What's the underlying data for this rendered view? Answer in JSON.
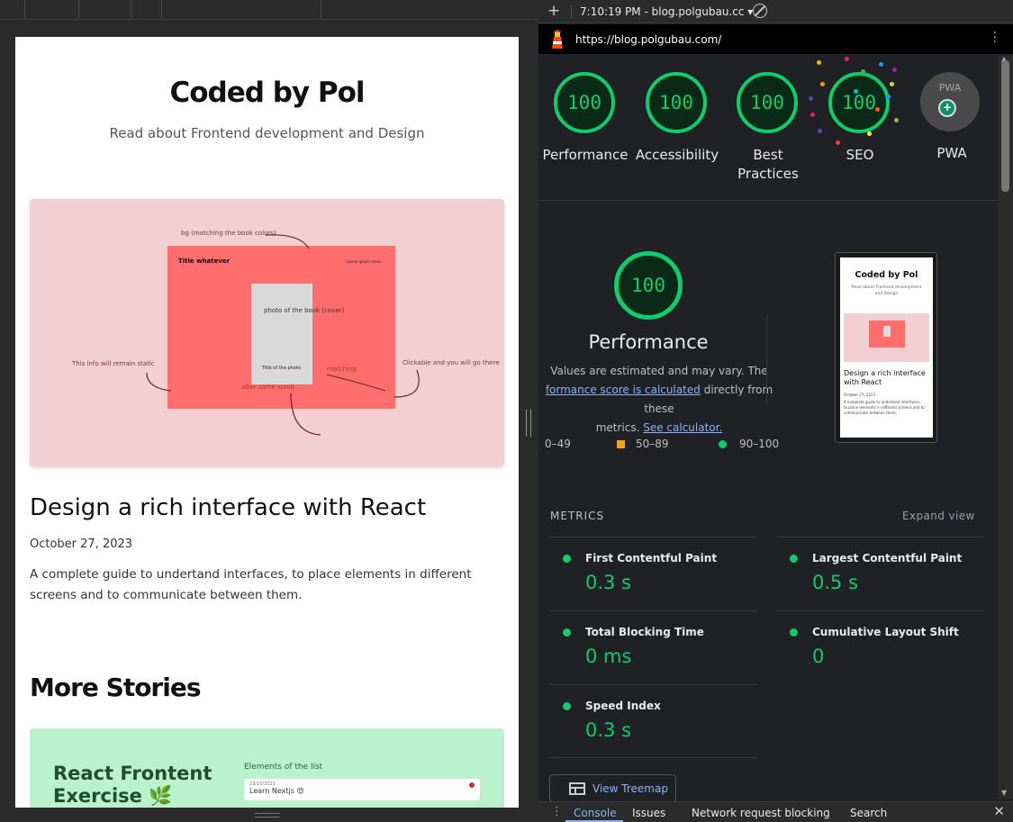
{
  "device": {
    "site_title": "Coded by Pol",
    "site_subtitle": "Read about Frontend development and Design",
    "hero_annotations": {
      "bg_note": "bg (matching the book colors)",
      "title_whatever": "Title whatever",
      "small_corner": "Lorem ipsum  more...",
      "photo_label": "photo of the book (cover)",
      "title_of_photo": "Title of the photo",
      "static_note": "This info will remain static",
      "matching": "matching",
      "after_scroll": "after some scroll",
      "clickable_note": "Clickable and you will go there"
    },
    "post": {
      "title": "Design a rich interface with React",
      "date": "October 27, 2023",
      "excerpt": "A complete guide to undertand interfaces, to place elements in different screens and to communicate between them."
    },
    "more_stories": "More Stories",
    "story_card": {
      "title": "React Frontent Exercise 🌿",
      "elements_label": "Elements of the list",
      "item_date": "23/10/2023",
      "item_text": "Learn Nextjs 😍"
    }
  },
  "devtools": {
    "toolbar": {
      "plus": "+",
      "report_label": "7:10:19 PM - blog.polgubau.cc ▾"
    },
    "url": "https://blog.polgubau.com/",
    "scores": [
      {
        "label": "Performance",
        "value": "100"
      },
      {
        "label": "Accessibility",
        "value": "100"
      },
      {
        "label": "Best Practices",
        "value": "100"
      },
      {
        "label": "SEO",
        "value": "100"
      }
    ],
    "pwa": {
      "label": "PWA",
      "badge_text": "PWA"
    },
    "performance": {
      "score": "100",
      "title": "Performance",
      "desc_1": "Values are estimated and may vary. The",
      "desc_link": "formance score is calculated",
      "desc_2": " directly from these",
      "desc_3": "metrics. ",
      "calc_link": "See calculator.",
      "legend": [
        "0–49",
        "50–89",
        "90–100"
      ]
    },
    "thumbnail": {
      "title": "Coded by Pol",
      "subtitle": "Read about Frontend development and Design",
      "post_title": "Design a rich interface with React",
      "date": "October 27, 2023",
      "excerpt": "A complete guide to undertand interfaces, to place elements in different screens and to communicate between them."
    },
    "metrics_heading": "METRICS",
    "expand_view": "Expand view",
    "metrics": [
      {
        "name": "First Contentful Paint",
        "value": "0.3 s"
      },
      {
        "name": "Largest Contentful Paint",
        "value": "0.5 s"
      },
      {
        "name": "Total Blocking Time",
        "value": "0 ms"
      },
      {
        "name": "Cumulative Layout Shift",
        "value": "0"
      },
      {
        "name": "Speed Index",
        "value": "0.3 s"
      }
    ],
    "treemap_button": "View Treemap",
    "drawer_tabs": [
      "Console",
      "Issues",
      "Network request blocking",
      "Search"
    ],
    "colors": {
      "pass": "#0cce6b",
      "average": "#ffa400",
      "link": "#8ab4f8",
      "hero_bg": "#f4cfd1",
      "hero_red": "#ff6d6d",
      "story_bg": "#b9f2cc"
    }
  }
}
